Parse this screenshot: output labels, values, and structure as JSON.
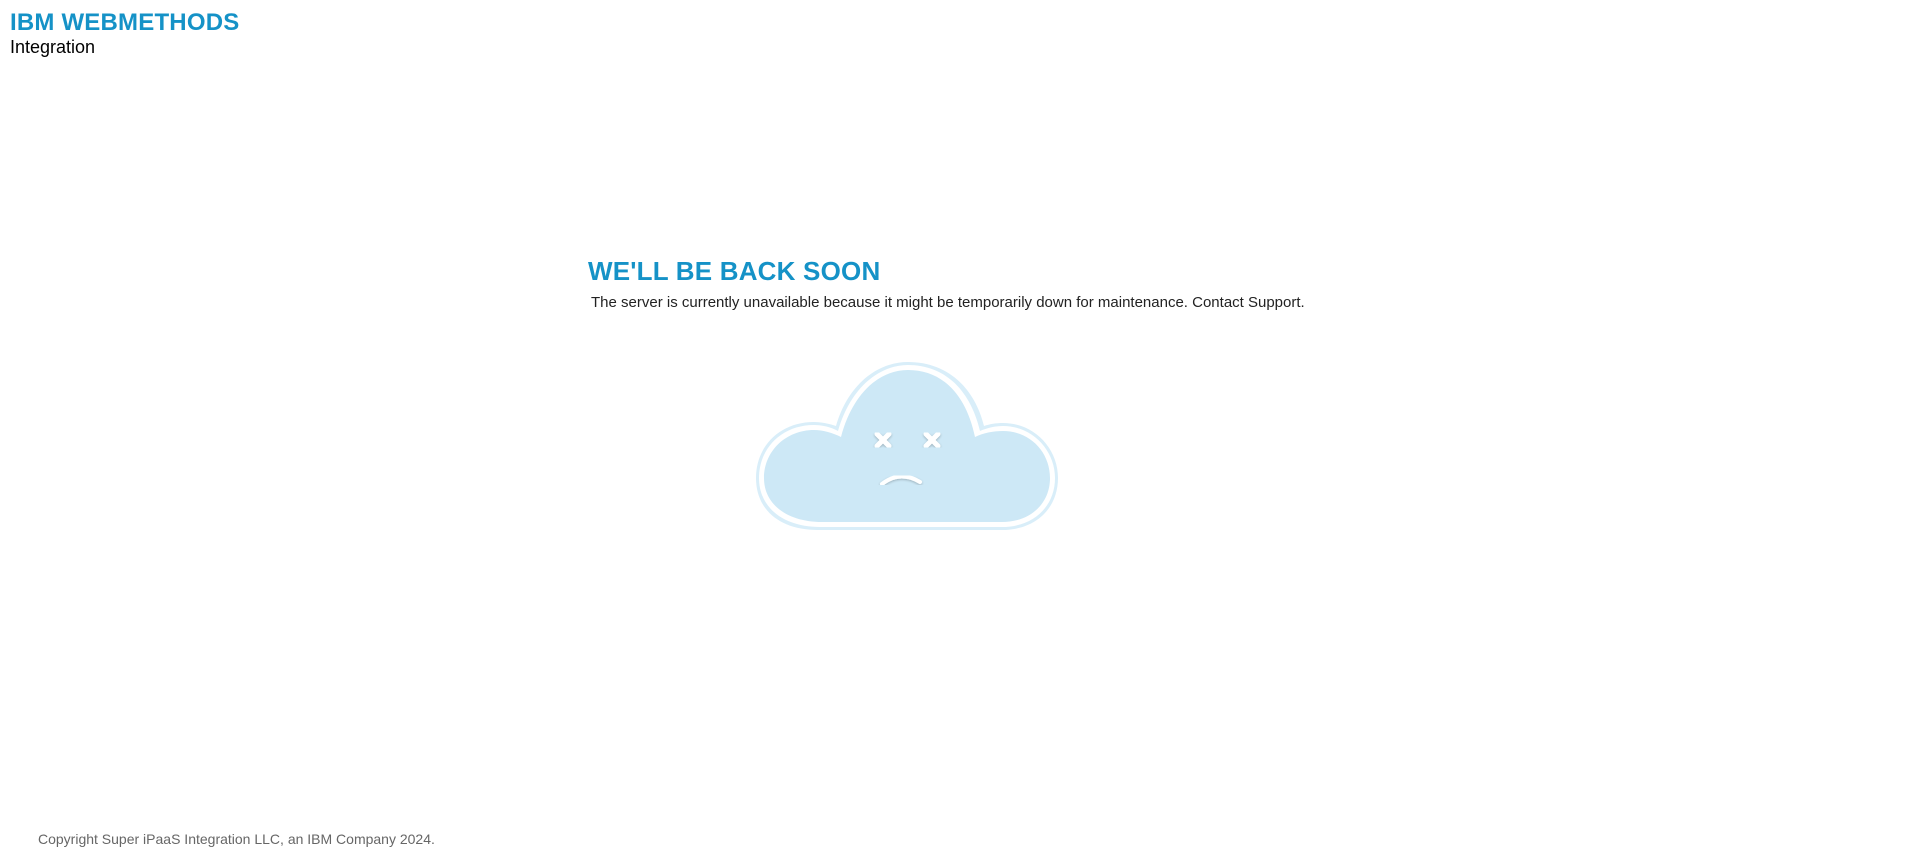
{
  "brand": {
    "title": "IBM WEBMETHODS",
    "subtitle": "Integration",
    "accent_color": "#1592c7"
  },
  "main": {
    "headline": "WE'LL BE BACK SOON",
    "message": "The server is currently unavailable because it might be temporarily down for maintenance. Contact Support."
  },
  "illustration": {
    "icon": "sad-cloud-icon",
    "fill_color": "#cde8f6",
    "outline_color": "#ffffff"
  },
  "footer": {
    "copyright": "Copyright Super iPaaS Integration LLC, an IBM Company 2024."
  }
}
